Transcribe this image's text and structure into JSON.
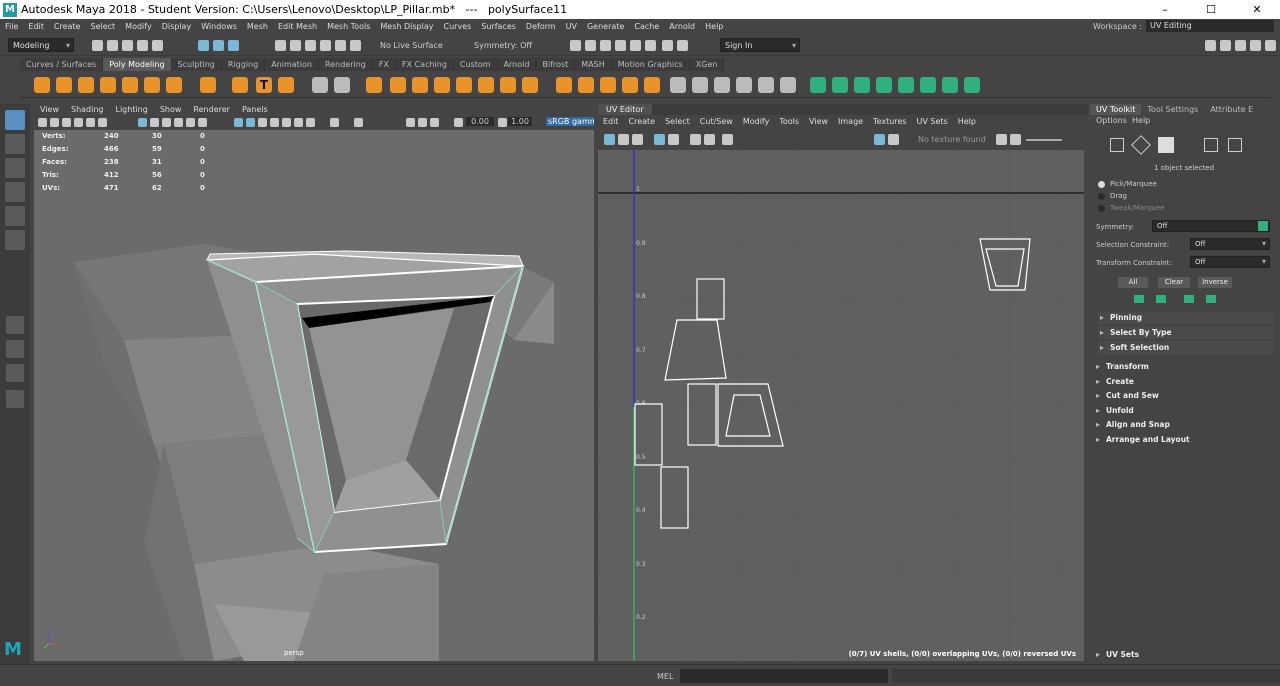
{
  "title": {
    "app": "Autodesk Maya 2018 - Student Version: C:\\Users\\Lenovo\\Desktop\\LP_Pillar.mb*   ---   polySurface11"
  },
  "window_controls": {
    "minimize": "–",
    "maximize": "☐",
    "close": "✕"
  },
  "menu": [
    "File",
    "Edit",
    "Create",
    "Select",
    "Modify",
    "Display",
    "Windows",
    "Mesh",
    "Edit Mesh",
    "Mesh Tools",
    "Mesh Display",
    "Curves",
    "Surfaces",
    "Deform",
    "UV",
    "Generate",
    "Cache",
    "Arnold",
    "Help"
  ],
  "workspace": {
    "label": "Workspace :",
    "value": "UV Editing"
  },
  "status": {
    "mode": "Modeling",
    "live_surface": "No Live Surface",
    "symmetry": "Symmetry: Off",
    "sign_in": "Sign In"
  },
  "shelf_tabs": [
    "Curves / Surfaces",
    "Poly Modeling",
    "Sculpting",
    "Rigging",
    "Animation",
    "Rendering",
    "FX",
    "FX Caching",
    "Custom",
    "Arnold",
    "Bifrost",
    "MASH",
    "Motion Graphics",
    "XGen"
  ],
  "shelf_active": "Poly Modeling",
  "viewport": {
    "menu": [
      "View",
      "Shading",
      "Lighting",
      "Show",
      "Renderer",
      "Panels"
    ],
    "gamma_label": "sRGB gamma",
    "val1": "0.00",
    "val2": "1.00",
    "camera": "persp",
    "hud": [
      {
        "label": "Verts:",
        "a": "240",
        "b": "30",
        "c": "0"
      },
      {
        "label": "Edges:",
        "a": "466",
        "b": "59",
        "c": "0"
      },
      {
        "label": "Faces:",
        "a": "238",
        "b": "31",
        "c": "0"
      },
      {
        "label": "Tris:",
        "a": "412",
        "b": "56",
        "c": "0"
      },
      {
        "label": "UVs:",
        "a": "471",
        "b": "62",
        "c": "0"
      }
    ]
  },
  "uv_editor": {
    "title": "UV Editor",
    "menu": [
      "Edit",
      "Create",
      "Select",
      "Cut/Sew",
      "Modify",
      "Tools",
      "View",
      "Image",
      "Textures",
      "UV Sets",
      "Help"
    ],
    "texture": "No texture found",
    "axis_labels": [
      "1",
      "0.9",
      "0.8",
      "0.7",
      "0.6",
      "0.5",
      "0.4",
      "0.3",
      "0.2"
    ],
    "status": "(0/7) UV shells, (0/0) overlapping UVs, (0/0) reversed UVs"
  },
  "uv_toolkit": {
    "tabs": [
      "UV Toolkit",
      "Tool Settings",
      "Attribute E"
    ],
    "submenu": [
      "Options",
      "Help"
    ],
    "selected": "1 object selected",
    "modes": [
      "Pick/Marquee",
      "Drag",
      "Tweak/Marquee"
    ],
    "symmetry": {
      "label": "Symmetry:",
      "value": "Off"
    },
    "selection_constraint": {
      "label": "Selection Constraint:",
      "value": "Off"
    },
    "transform_constraint": {
      "label": "Transform Constraint:",
      "value": "Off"
    },
    "buttons": [
      "All",
      "Clear",
      "Inverse"
    ],
    "sections_a": [
      "Pinning",
      "Select By Type",
      "Soft Selection"
    ],
    "sections_b": [
      "Transform",
      "Create",
      "Cut and Sew",
      "Unfold",
      "Align and Snap",
      "Arrange and Layout"
    ],
    "uv_sets": "UV Sets"
  },
  "command_line": {
    "label": "MEL"
  }
}
